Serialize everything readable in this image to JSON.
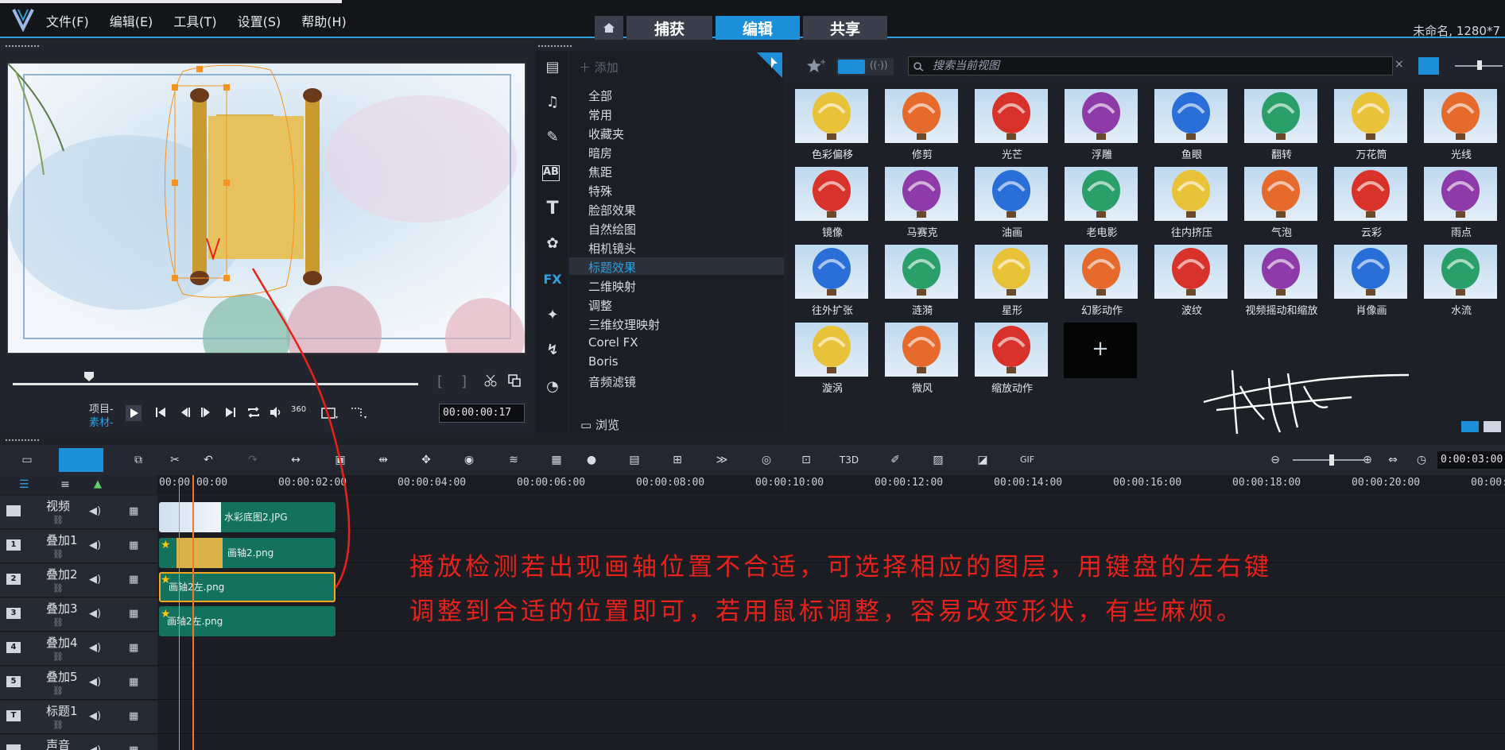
{
  "menu": [
    "文件(F)",
    "编辑(E)",
    "工具(T)",
    "设置(S)",
    "帮助(H)"
  ],
  "tabs": {
    "capture": "捕获",
    "edit": "编辑",
    "share": "共享"
  },
  "project_info": "未命名, 1280*7",
  "preview": {
    "project_label": "项目-",
    "material_label": "素材-",
    "timecode": "00:00:00:17"
  },
  "library": {
    "add_label": "添加",
    "search_placeholder": "搜索当前视图",
    "categories": [
      "全部",
      "常用",
      "收藏夹",
      "暗房",
      "焦距",
      "特殊",
      "脸部效果",
      "自然绘图",
      "相机镜头",
      "标题效果",
      "二维映射",
      "调整",
      "三维纹理映射",
      "Corel FX",
      "Boris",
      "音频滤镜"
    ],
    "selected_category_index": 9,
    "browse_label": "浏览",
    "thumbnails": [
      "色彩偏移",
      "修剪",
      "光芒",
      "浮雕",
      "鱼眼",
      "翻转",
      "万花筒",
      "光线",
      "镜像",
      "马赛克",
      "油画",
      "老电影",
      "往内挤压",
      "气泡",
      "云彩",
      "雨点",
      "往外扩张",
      "涟漪",
      "星形",
      "幻影动作",
      "波纹",
      "视频摇动和缩放",
      "肖像画",
      "水流",
      "漩涡",
      "微风",
      "缩放动作"
    ]
  },
  "timeline": {
    "zoom_time": "0:00:03:00",
    "ticks": [
      "00:00:00:00",
      "00:00:02:00",
      "00:00:04:00",
      "00:00:06:00",
      "00:00:08:00",
      "00:00:10:00",
      "00:00:12:00",
      "00:00:14:00",
      "00:00:16:00",
      "00:00:18:00",
      "00:00:20:00",
      "00:00:2"
    ],
    "tracks": [
      {
        "name": "视频",
        "num": ""
      },
      {
        "name": "叠加1",
        "num": "1"
      },
      {
        "name": "叠加2",
        "num": "2"
      },
      {
        "name": "叠加3",
        "num": "3"
      },
      {
        "name": "叠加4",
        "num": "4"
      },
      {
        "name": "叠加5",
        "num": "5"
      },
      {
        "name": "标题1",
        "num": "T"
      },
      {
        "name": "声音",
        "num": ""
      }
    ],
    "clips": [
      "水彩底图2.JPG",
      "画轴2.png",
      "画轴2左.png",
      "画轴2左.png"
    ]
  },
  "annotation": {
    "line1": "播放检测若出现画轴位置不合适，可选择相应的图层，用键盘的左右键",
    "line2": "调整到合适的位置即可，若用鼠标调整，容易改变形状，有些麻烦。"
  },
  "colors": {
    "accent": "#1d8fd8",
    "clip": "#13725e",
    "annotation": "#e8211b",
    "playhead": "#f07a2a"
  }
}
